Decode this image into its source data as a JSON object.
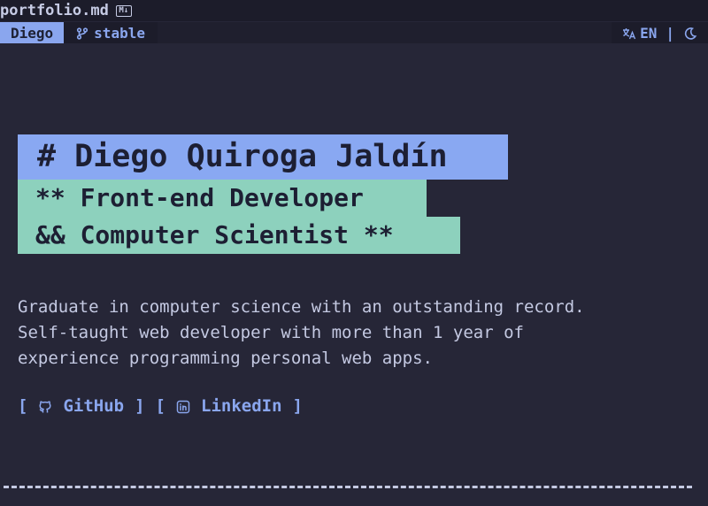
{
  "tab": {
    "filename": "portfolio.md",
    "file_type_icon": "markdown-icon"
  },
  "statusbar": {
    "mode_label": "Diego",
    "branch_icon": "git-branch-icon",
    "branch_label": "stable",
    "lang_icon": "translate-icon",
    "lang_label": "EN",
    "separator": "|",
    "theme_icon": "moon-icon"
  },
  "hero": {
    "heading": "# Diego Quiroga Jaldín",
    "subheading_line1": "** Front-end Developer",
    "subheading_line2": "&& Computer Scientist **"
  },
  "about": {
    "lines": [
      "Graduate in computer science with an outstanding record.",
      "Self-taught web developer with more than 1 year of",
      "experience programming personal web apps."
    ]
  },
  "links": {
    "open_bracket": "[",
    "close_bracket": "]",
    "github_label": "GitHub",
    "linkedin_label": "LinkedIn"
  },
  "colors": {
    "background": "#262637",
    "accent_blue": "#89a8f2",
    "accent_teal": "#8dd1bd",
    "text": "#c4c9e2"
  }
}
